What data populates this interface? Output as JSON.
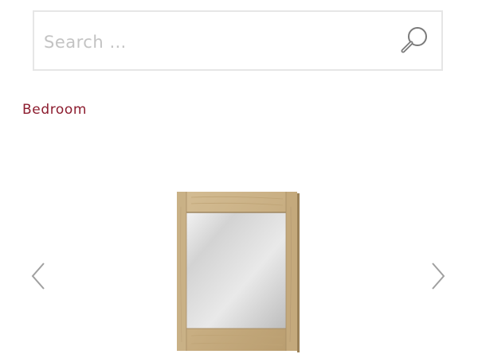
{
  "search": {
    "placeholder": "Search …",
    "value": ""
  },
  "breadcrumb": {
    "category": "Bedroom"
  },
  "carousel": {
    "prev_icon": "chevron-left-icon",
    "next_icon": "chevron-right-icon",
    "product_image": "wall-mirror-oak-frame"
  },
  "colors": {
    "accent": "#8c1c2e",
    "border": "#e6e6e6",
    "placeholder": "#c3c3c3",
    "arrow": "#a0a0a0"
  }
}
